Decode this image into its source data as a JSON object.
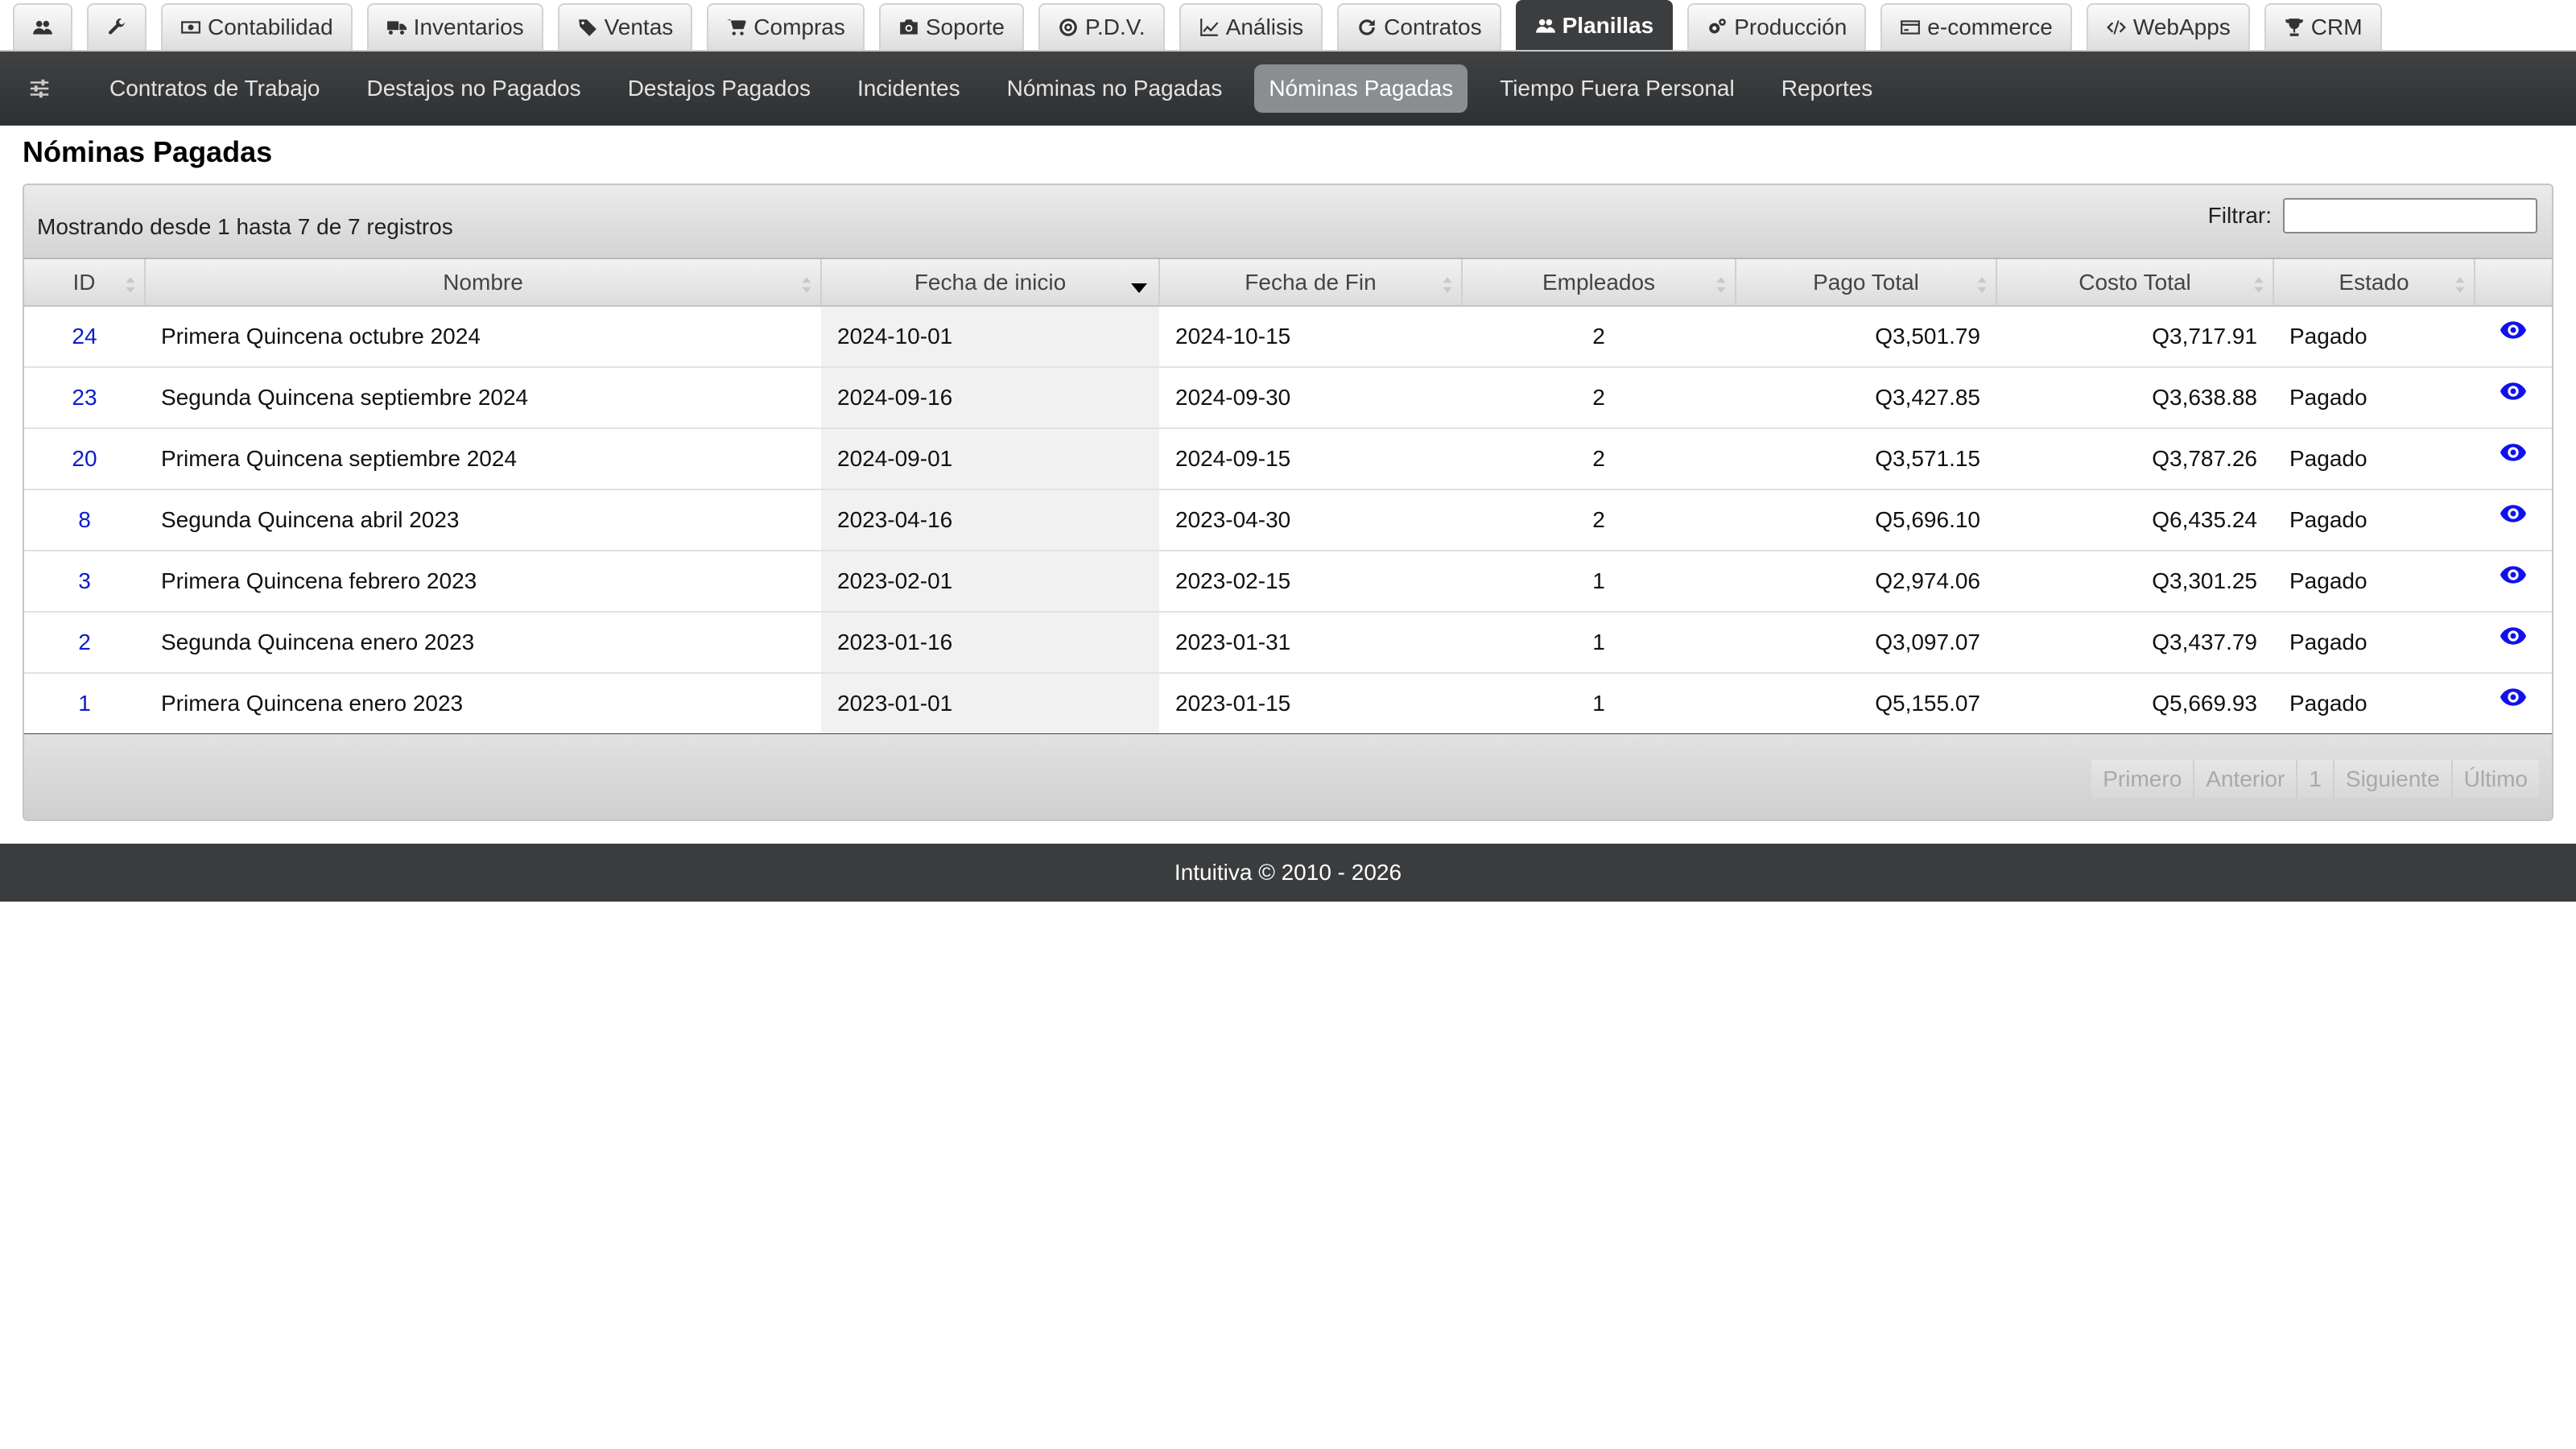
{
  "top_tabs": [
    {
      "label": "",
      "icon": "users-icon"
    },
    {
      "label": "",
      "icon": "wrench-icon"
    },
    {
      "label": "Contabilidad",
      "icon": "money-icon"
    },
    {
      "label": "Inventarios",
      "icon": "truck-icon"
    },
    {
      "label": "Ventas",
      "icon": "tags-icon"
    },
    {
      "label": "Compras",
      "icon": "cart-icon"
    },
    {
      "label": "Soporte",
      "icon": "camera-icon"
    },
    {
      "label": "P.D.V.",
      "icon": "target-icon"
    },
    {
      "label": "Análisis",
      "icon": "line-chart-icon"
    },
    {
      "label": "Contratos",
      "icon": "refresh-icon"
    },
    {
      "label": "Planillas",
      "icon": "users-icon",
      "active": true
    },
    {
      "label": "Producción",
      "icon": "gears-icon"
    },
    {
      "label": "e-commerce",
      "icon": "credit-card-icon"
    },
    {
      "label": "WebApps",
      "icon": "code-icon"
    },
    {
      "label": "CRM",
      "icon": "trophy-icon"
    }
  ],
  "sub_nav": {
    "menu_icon": "sliders-icon",
    "items": [
      "Contratos de Trabajo",
      "Destajos no Pagados",
      "Destajos Pagados",
      "Incidentes",
      "Nóminas no Pagadas",
      "Nóminas Pagadas",
      "Tiempo Fuera Personal",
      "Reportes"
    ],
    "active_index": 5
  },
  "page": {
    "title": "Nóminas Pagadas"
  },
  "table": {
    "info": "Mostrando desde 1 hasta 7 de 7 registros",
    "filter_label": "Filtrar:",
    "filter_value": "",
    "columns": [
      "ID",
      "Nombre",
      "Fecha de inicio",
      "Fecha de Fin",
      "Empleados",
      "Pago Total",
      "Costo Total",
      "Estado",
      ""
    ],
    "sorted_column": 2,
    "sort_direction": "desc",
    "rows": [
      {
        "id": "24",
        "nombre": "Primera Quincena octubre 2024",
        "inicio": "2024-10-01",
        "fin": "2024-10-15",
        "empleados": "2",
        "pago": "Q3,501.79",
        "costo": "Q3,717.91",
        "estado": "Pagado"
      },
      {
        "id": "23",
        "nombre": "Segunda Quincena septiembre 2024",
        "inicio": "2024-09-16",
        "fin": "2024-09-30",
        "empleados": "2",
        "pago": "Q3,427.85",
        "costo": "Q3,638.88",
        "estado": "Pagado"
      },
      {
        "id": "20",
        "nombre": "Primera Quincena septiembre 2024",
        "inicio": "2024-09-01",
        "fin": "2024-09-15",
        "empleados": "2",
        "pago": "Q3,571.15",
        "costo": "Q3,787.26",
        "estado": "Pagado"
      },
      {
        "id": "8",
        "nombre": "Segunda Quincena abril 2023",
        "inicio": "2023-04-16",
        "fin": "2023-04-30",
        "empleados": "2",
        "pago": "Q5,696.10",
        "costo": "Q6,435.24",
        "estado": "Pagado"
      },
      {
        "id": "3",
        "nombre": "Primera Quincena febrero 2023",
        "inicio": "2023-02-01",
        "fin": "2023-02-15",
        "empleados": "1",
        "pago": "Q2,974.06",
        "costo": "Q3,301.25",
        "estado": "Pagado"
      },
      {
        "id": "2",
        "nombre": "Segunda Quincena enero 2023",
        "inicio": "2023-01-16",
        "fin": "2023-01-31",
        "empleados": "1",
        "pago": "Q3,097.07",
        "costo": "Q3,437.79",
        "estado": "Pagado"
      },
      {
        "id": "1",
        "nombre": "Primera Quincena enero 2023",
        "inicio": "2023-01-01",
        "fin": "2023-01-15",
        "empleados": "1",
        "pago": "Q5,155.07",
        "costo": "Q5,669.93",
        "estado": "Pagado"
      }
    ],
    "row_action_icon": "eye-icon",
    "pager": [
      "Primero",
      "Anterior",
      "1",
      "Siguiente",
      "Último"
    ]
  },
  "footer": {
    "text": "Intuitiva © 2010 - 2026"
  },
  "colors": {
    "link": "#0b1ccc",
    "dark_bar": "#3a3c3e",
    "active_pill": "#8b8e91"
  }
}
